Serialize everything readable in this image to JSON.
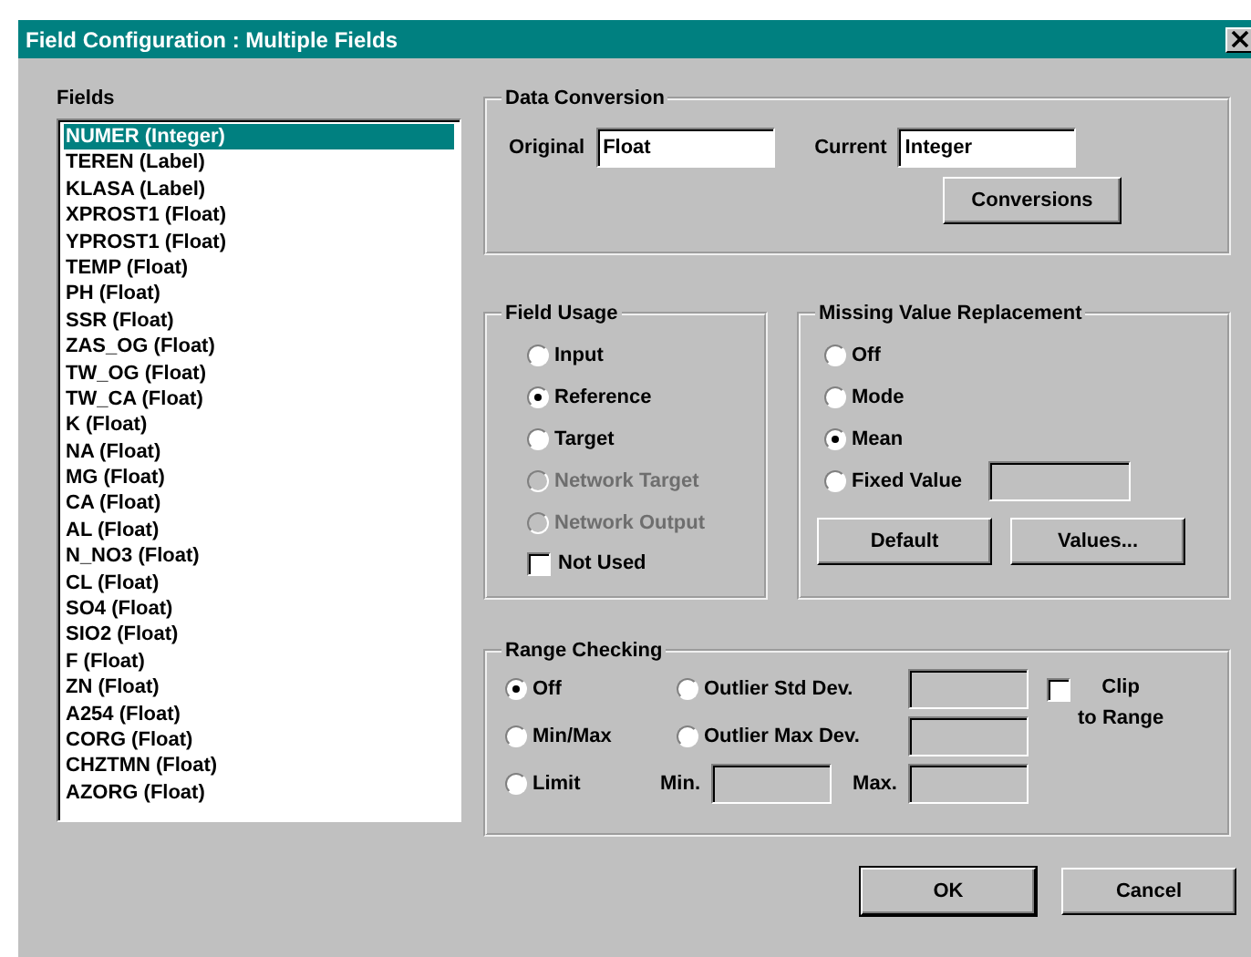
{
  "window": {
    "title": "Field Configuration : Multiple Fields"
  },
  "fields": {
    "label": "Fields",
    "items": [
      {
        "text": "NUMER (Integer)",
        "selected": true
      },
      {
        "text": "TEREN (Label)",
        "selected": false
      },
      {
        "text": "KLASA (Label)",
        "selected": false
      },
      {
        "text": "XPROST1 (Float)",
        "selected": false
      },
      {
        "text": "YPROST1 (Float)",
        "selected": false
      },
      {
        "text": "TEMP (Float)",
        "selected": false
      },
      {
        "text": "PH (Float)",
        "selected": false
      },
      {
        "text": "SSR (Float)",
        "selected": false
      },
      {
        "text": "ZAS_OG (Float)",
        "selected": false
      },
      {
        "text": "TW_OG (Float)",
        "selected": false
      },
      {
        "text": "TW_CA (Float)",
        "selected": false
      },
      {
        "text": "K (Float)",
        "selected": false
      },
      {
        "text": "NA (Float)",
        "selected": false
      },
      {
        "text": "MG (Float)",
        "selected": false
      },
      {
        "text": "CA (Float)",
        "selected": false
      },
      {
        "text": "AL (Float)",
        "selected": false
      },
      {
        "text": "N_NO3 (Float)",
        "selected": false
      },
      {
        "text": "CL (Float)",
        "selected": false
      },
      {
        "text": "SO4 (Float)",
        "selected": false
      },
      {
        "text": "SIO2 (Float)",
        "selected": false
      },
      {
        "text": "F (Float)",
        "selected": false
      },
      {
        "text": "ZN (Float)",
        "selected": false
      },
      {
        "text": "A254 (Float)",
        "selected": false
      },
      {
        "text": "CORG (Float)",
        "selected": false
      },
      {
        "text": "CHZTMN (Float)",
        "selected": false
      },
      {
        "text": "AZORG (Float)",
        "selected": false
      }
    ]
  },
  "data_conversion": {
    "title": "Data Conversion",
    "original": {
      "label": "Original",
      "value": "Float"
    },
    "current": {
      "label": "Current",
      "value": "Integer"
    },
    "button": "Conversions"
  },
  "field_usage": {
    "title": "Field Usage",
    "options": [
      {
        "label": "Input",
        "selected": false,
        "disabled": false
      },
      {
        "label": "Reference",
        "selected": true,
        "disabled": false
      },
      {
        "label": "Target",
        "selected": false,
        "disabled": false
      },
      {
        "label": "Network Target",
        "selected": false,
        "disabled": true
      },
      {
        "label": "Network Output",
        "selected": false,
        "disabled": true
      }
    ],
    "not_used": {
      "label": "Not Used",
      "checked": false
    }
  },
  "missing_value": {
    "title": "Missing Value Replacement",
    "options": [
      {
        "label": "Off",
        "selected": false
      },
      {
        "label": "Mode",
        "selected": false
      },
      {
        "label": "Mean",
        "selected": true
      },
      {
        "label": "Fixed Value",
        "selected": false
      }
    ],
    "buttons": [
      "Default",
      "Values..."
    ]
  },
  "range_checking": {
    "title": "Range Checking",
    "options": [
      {
        "label": "Off",
        "selected": true
      },
      {
        "label": "Min/Max",
        "selected": false
      },
      {
        "label": "Limit",
        "selected": false
      },
      {
        "label": "Outlier Std Dev.",
        "selected": false
      },
      {
        "label": "Outlier Max Dev.",
        "selected": false
      }
    ],
    "limit_labels": [
      "Min.",
      "Max."
    ],
    "clip": {
      "label_lines": [
        "Clip",
        "to Range"
      ],
      "checked": false
    }
  },
  "buttons": [
    "OK",
    "Cancel"
  ]
}
